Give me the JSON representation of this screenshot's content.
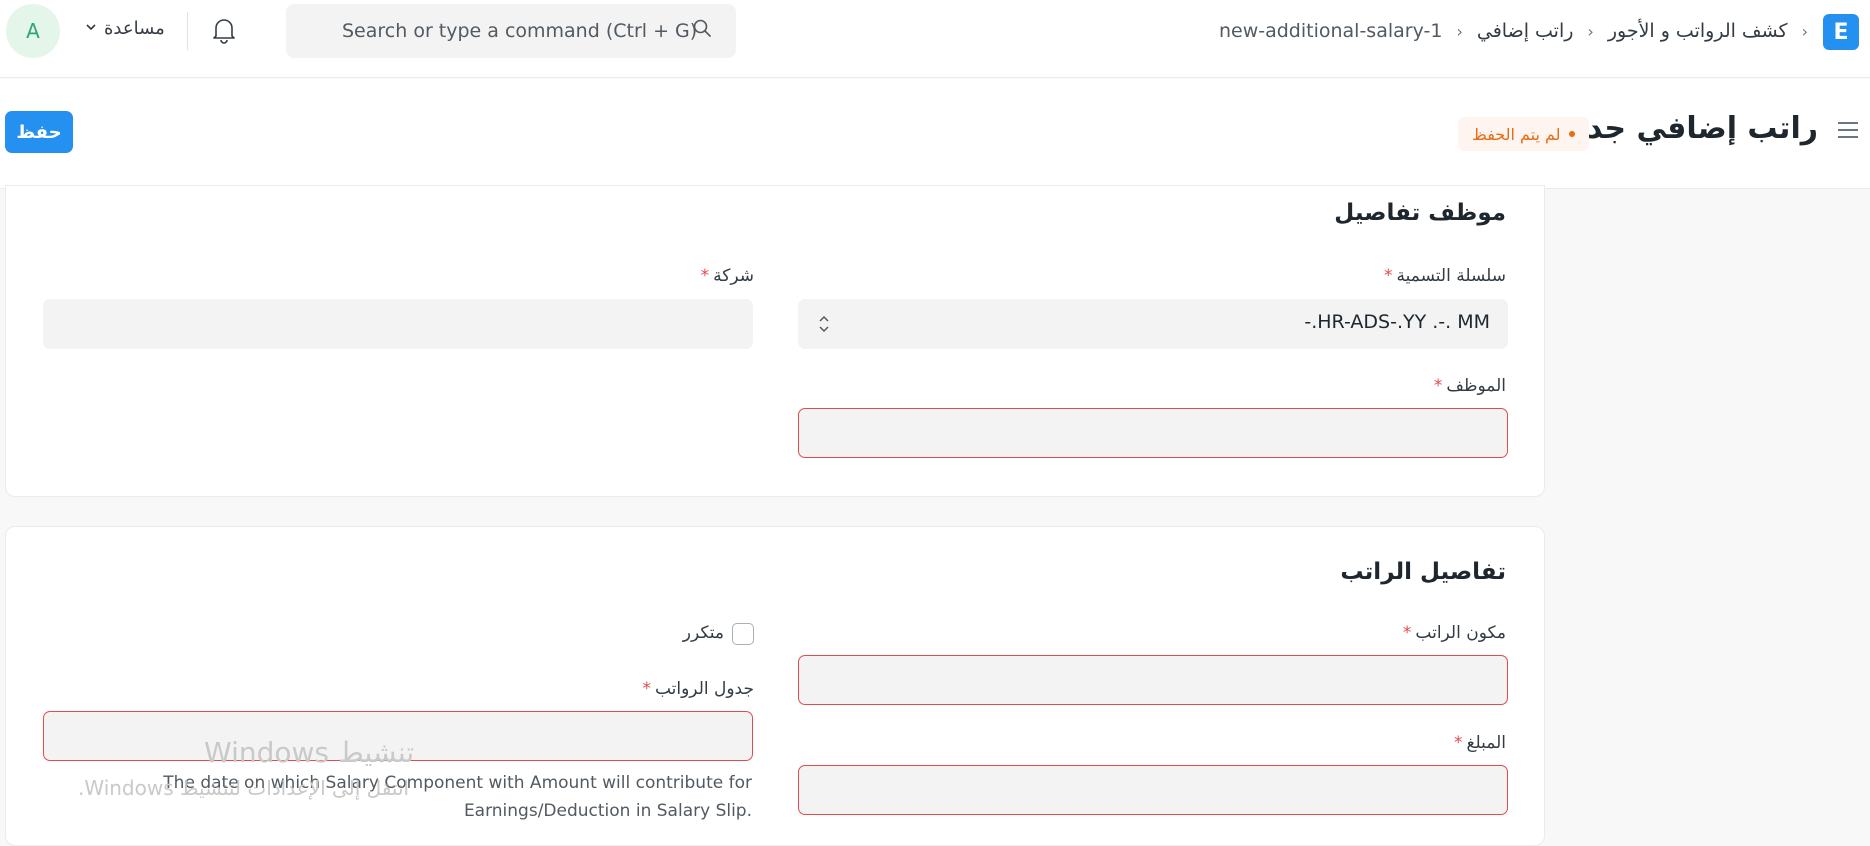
{
  "navbar": {
    "logo_letter": "E",
    "breadcrumbs": [
      "كشف الرواتب و الأجور",
      "راتب إضافي",
      "new-additional-salary-1"
    ],
    "search_placeholder": "Search or type a command (Ctrl + G)",
    "help_label": "مساعدة",
    "avatar_letter": "A"
  },
  "page": {
    "title": "راتب إضافي جديد",
    "status_badge": "لم يتم الحفظ",
    "save_label": "حفظ"
  },
  "employee_section": {
    "title": "موظف تفاصيل",
    "naming_series_label": "سلسلة التسمية",
    "naming_series_value": "-.HR-ADS-.YY .-. MM",
    "company_label": "شركة",
    "company_value": "",
    "employee_label": "الموظف",
    "employee_value": ""
  },
  "salary_section": {
    "title": "تفاصيل الراتب",
    "salary_component_label": "مكون الراتب",
    "recurring_label": "متكرر",
    "payroll_date_label": "جدول الرواتب",
    "amount_label": "المبلغ",
    "payroll_date_help_line1": "The date on which Salary Component with Amount will contribute for",
    "payroll_date_help_line2": "Earnings/Deduction in Salary Slip."
  },
  "watermark": {
    "line1": "تنشيط Windows",
    "line2": "انتقل إلى الإعدادات لتنشيط Windows."
  },
  "colors": {
    "primary": "#2490ef",
    "danger": "#e24c4c",
    "badge_text": "#e86c13"
  }
}
